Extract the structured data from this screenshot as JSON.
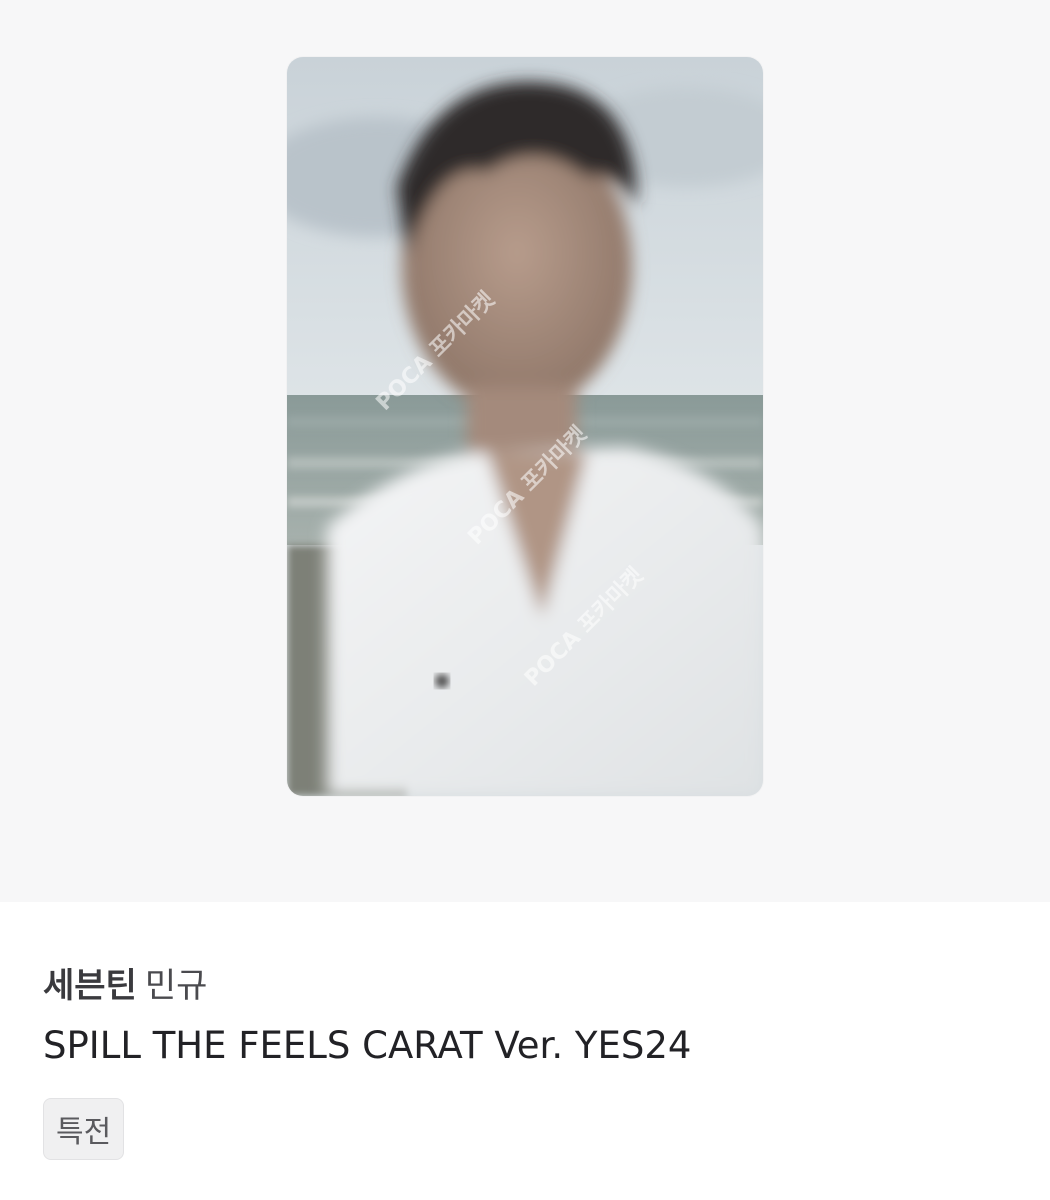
{
  "image": {
    "description_icon": "photocard-image",
    "watermark_text": "POCA 포카마켓"
  },
  "listing": {
    "group": "세븐틴",
    "member": "민규",
    "album": "SPILL THE FEELS CARAT Ver. YES24",
    "tag": "특전"
  },
  "colors": {
    "hero_background": "#f7f7f8",
    "text_primary": "#222226",
    "tag_background": "#f0f0f1"
  }
}
